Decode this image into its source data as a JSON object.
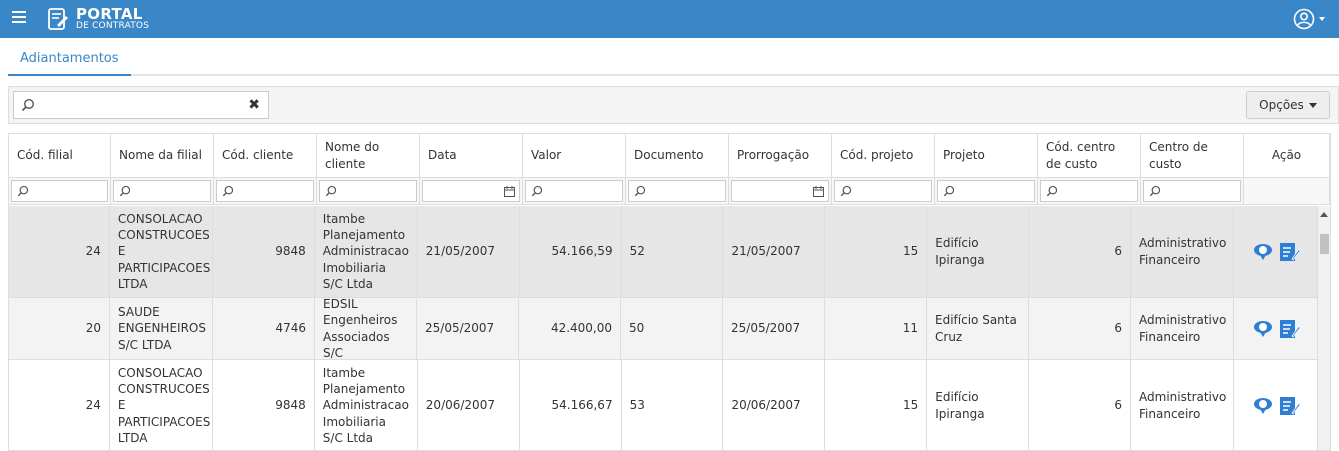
{
  "header": {
    "logo_main": "PORTAL",
    "logo_sub": "DE CONTRATOS"
  },
  "tabs": [
    {
      "label": "Adiantamentos"
    }
  ],
  "toolbar": {
    "search_value": "",
    "options_label": "Opções"
  },
  "table": {
    "columns": [
      "Cód. filial",
      "Nome da filial",
      "Cód. cliente",
      "Nome do cliente",
      "Data",
      "Valor",
      "Documento",
      "Prorrogação",
      "Cód. projeto",
      "Projeto",
      "Cód. centro de custo",
      "Centro de custo",
      "Ação"
    ],
    "rows": [
      {
        "cod_filial": "24",
        "nome_filial": "CONSOLACAO CONSTRUCOES E PARTICIPACOES LTDA",
        "cod_cliente": "9848",
        "nome_cliente": "Itambe Planejamento Administracao Imobiliaria S/C Ltda",
        "data": "21/05/2007",
        "valor": "54.166,59",
        "documento": "52",
        "prorrogacao": "21/05/2007",
        "cod_projeto": "15",
        "projeto": "Edifício Ipiranga",
        "cod_centro": "6",
        "centro": "Administrativo Financeiro"
      },
      {
        "cod_filial": "20",
        "nome_filial": "SAUDE ENGENHEIROS S/C LTDA",
        "cod_cliente": "4746",
        "nome_cliente": "EDSIL Engenheiros Associados S/C",
        "data": "25/05/2007",
        "valor": "42.400,00",
        "documento": "50",
        "prorrogacao": "25/05/2007",
        "cod_projeto": "11",
        "projeto": "Edifício Santa Cruz",
        "cod_centro": "6",
        "centro": "Administrativo Financeiro"
      },
      {
        "cod_filial": "24",
        "nome_filial": "CONSOLACAO CONSTRUCOES E PARTICIPACOES LTDA",
        "cod_cliente": "9848",
        "nome_cliente": "Itambe Planejamento Administracao Imobiliaria S/C Ltda",
        "data": "20/06/2007",
        "valor": "54.166,67",
        "documento": "53",
        "prorrogacao": "20/06/2007",
        "cod_projeto": "15",
        "projeto": "Edifício Ipiranga",
        "cod_centro": "6",
        "centro": "Administrativo Financeiro"
      }
    ]
  },
  "colors": {
    "topbar": "#3a87c8",
    "accent": "#3a87c8",
    "selected_row": "#e6e6e6"
  },
  "icons": {
    "menu": "hamburger-icon",
    "logo": "contract-logo-icon",
    "user": "user-circle-icon",
    "search": "search-icon",
    "clear": "close-icon",
    "calendar": "calendar-icon",
    "action_money": "money-icon",
    "action_edit": "edit-document-icon"
  }
}
